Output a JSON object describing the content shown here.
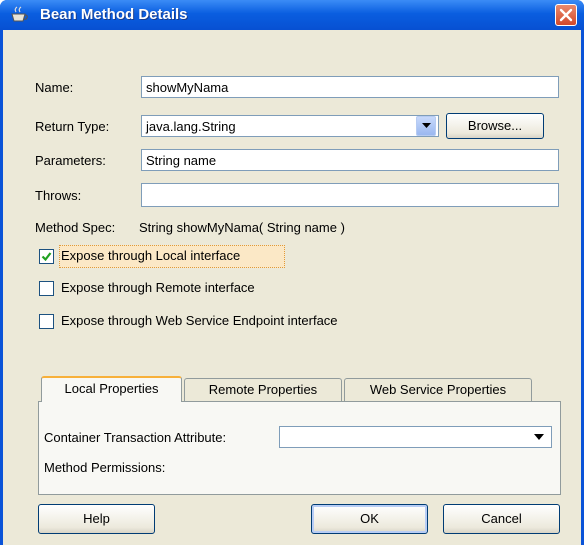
{
  "window": {
    "title": "Bean Method Details",
    "icon": "bean-icon"
  },
  "form": {
    "name_label": "Name:",
    "name_value": "showMyNama",
    "return_type_label": "Return Type:",
    "return_type_value": "java.lang.String",
    "browse_label": "Browse...",
    "parameters_label": "Parameters:",
    "parameters_value": "String name",
    "throws_label": "Throws:",
    "throws_value": "",
    "method_spec_label": "Method Spec:",
    "method_spec_value": "String showMyNama( String name )"
  },
  "checkboxes": [
    {
      "label": "Expose through Local interface",
      "checked": true
    },
    {
      "label": "Expose through Remote interface",
      "checked": false
    },
    {
      "label": "Expose through Web Service Endpoint interface",
      "checked": false
    }
  ],
  "tabs": [
    {
      "label": "Local Properties",
      "active": true
    },
    {
      "label": "Remote Properties",
      "active": false
    },
    {
      "label": "Web Service Properties",
      "active": false
    }
  ],
  "local_properties": {
    "container_transaction_label": "Container Transaction Attribute:",
    "container_transaction_value": "",
    "method_permissions_label": "Method Permissions:"
  },
  "buttons": {
    "help": "Help",
    "ok": "OK",
    "cancel": "Cancel"
  },
  "colors": {
    "titlebar": "#0a5ee0",
    "dialog_bg": "#ece9d8",
    "close": "#d2482a",
    "active_tab_accent": "#f7b03a"
  }
}
